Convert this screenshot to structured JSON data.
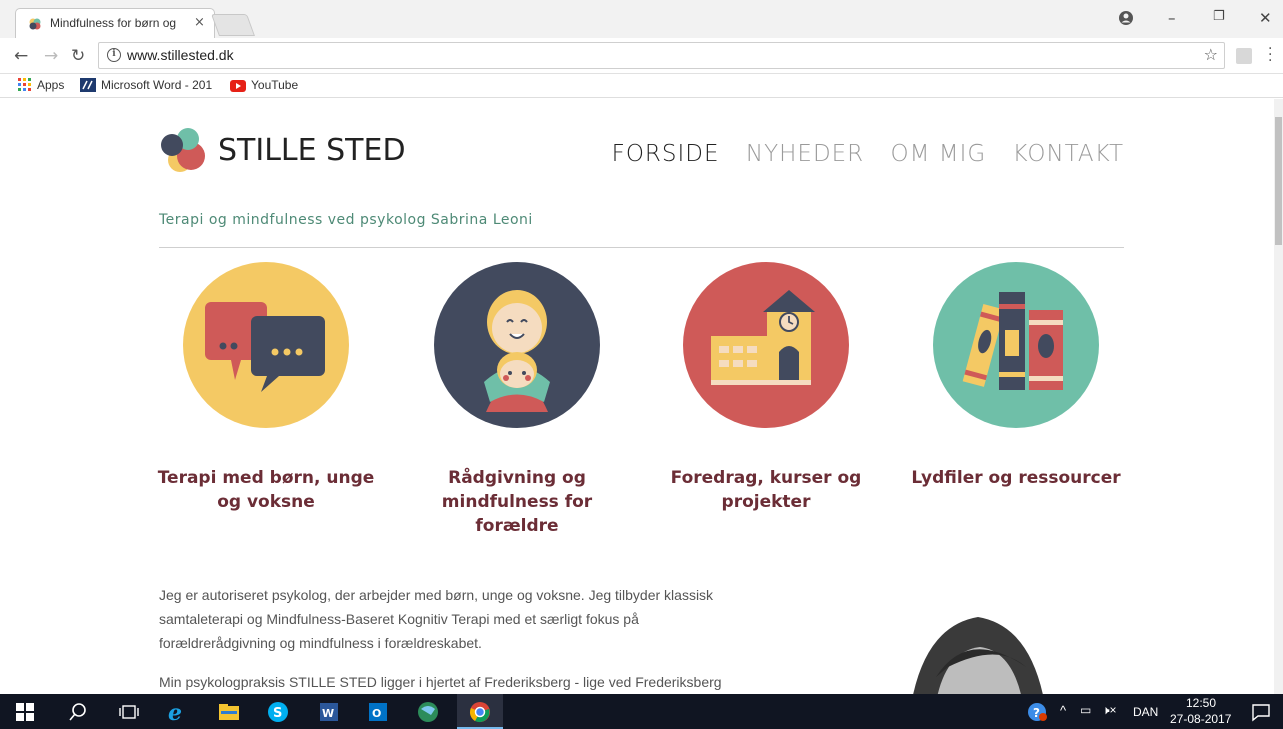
{
  "browser": {
    "tab_title": "Mindfulness for børn og",
    "tab_close": "×",
    "url": "www.stillested.dk",
    "bookmarks": [
      {
        "label": "Apps"
      },
      {
        "label": "Microsoft Word - 201"
      },
      {
        "label": "YouTube"
      }
    ],
    "window_controls": {
      "minimize": "–",
      "restore": "❐",
      "close": "✕"
    }
  },
  "site": {
    "logo_text": "STILLE STED",
    "nav": [
      {
        "label": "FORSIDE",
        "active": true
      },
      {
        "label": "NYHEDER",
        "active": false
      },
      {
        "label": "OM MIG",
        "active": false
      },
      {
        "label": "KONTAKT",
        "active": false
      }
    ],
    "tagline": "Terapi og mindfulness ved psykolog Sabrina Leoni",
    "cards": [
      {
        "title": "Terapi med børn, unge og voksne",
        "icon": "speech-bubbles-icon",
        "color": "#f4c964"
      },
      {
        "title": "Rådgivning og mindfulness for forældre",
        "icon": "parent-child-icon",
        "color": "#424a5e"
      },
      {
        "title": "Foredrag, kurser og projekter",
        "icon": "school-building-icon",
        "color": "#cf5a58"
      },
      {
        "title": "Lydfiler og ressourcer",
        "icon": "books-icon",
        "color": "#6fbfa8"
      }
    ],
    "paragraphs": [
      "Jeg er autoriseret psykolog, der arbejder med børn, unge og voksne. Jeg tilbyder klassisk samtaleterapi og Mindfulness-Baseret Kognitiv Terapi med et særligt fokus på forældrerådgivning og mindfulness i forældreskabet.",
      "Min psykologpraksis STILLE STED ligger i hjertet af Frederiksberg - lige ved Frederiksberg"
    ],
    "colors": {
      "accent_green": "#4e8a76",
      "card_title": "#6b2d36",
      "nav_active": "#222222",
      "nav_inactive": "#9a9a9a"
    }
  },
  "taskbar": {
    "language": "DAN",
    "time": "12:50",
    "date": "27-08-2017"
  }
}
